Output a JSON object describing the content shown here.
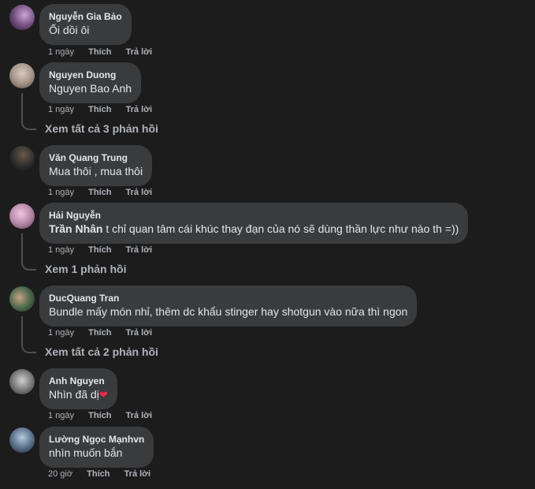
{
  "comments": [
    {
      "author": "Nguyễn Gia Bảo",
      "text": "Ối dồi ôi",
      "time": "1 ngày",
      "like": "Thích",
      "reply": "Trả lời",
      "avatar_color": "#6b4a78"
    },
    {
      "author": "Nguyen Duong",
      "text": "Nguyen Bao Anh",
      "time": "1 ngày",
      "like": "Thích",
      "reply": "Trả lời",
      "view_replies": "Xem tất cả 3 phản hồi",
      "avatar_color": "#a7968b"
    },
    {
      "author": "Văn Quang Trung",
      "text": "Mua thôi , mua thôi",
      "time": "1 ngày",
      "like": "Thích",
      "reply": "Trả lời",
      "avatar_color": "#2b2b2b"
    },
    {
      "author": "Hải Nguyễn",
      "mention": "Trần Nhân",
      "text": " t chỉ quan tâm cái khúc thay đạn của nó sẽ dùng thần lực như nào th =))",
      "time": "1 ngày",
      "like": "Thích",
      "reply": "Trả lời",
      "view_replies": "Xem 1 phản hồi",
      "avatar_color": "#b58aa8"
    },
    {
      "author": "DucQuang Tran",
      "text": "Bundle mấy món nhỉ, thêm dc khẩu stinger hay shotgun vào nữa thì ngon",
      "time": "1 ngày",
      "like": "Thích",
      "reply": "Trả lời",
      "view_replies": "Xem tất cả 2 phản hồi",
      "avatar_color": "#4d6b4e"
    },
    {
      "author": "Anh Nguyen",
      "text": "Nhìn đã dị",
      "time": "1 ngày",
      "like": "Thích",
      "reply": "Trả lời",
      "avatar_color": "#7d7d7d"
    },
    {
      "author": "Lường Ngọc Mạnhvn",
      "text": "nhìn muốn bắn",
      "time": "20 giờ",
      "like": "Thích",
      "reply": "Trả lời",
      "avatar_color": "#5d7590"
    }
  ],
  "icons": {
    "heart": "heart-icon"
  }
}
